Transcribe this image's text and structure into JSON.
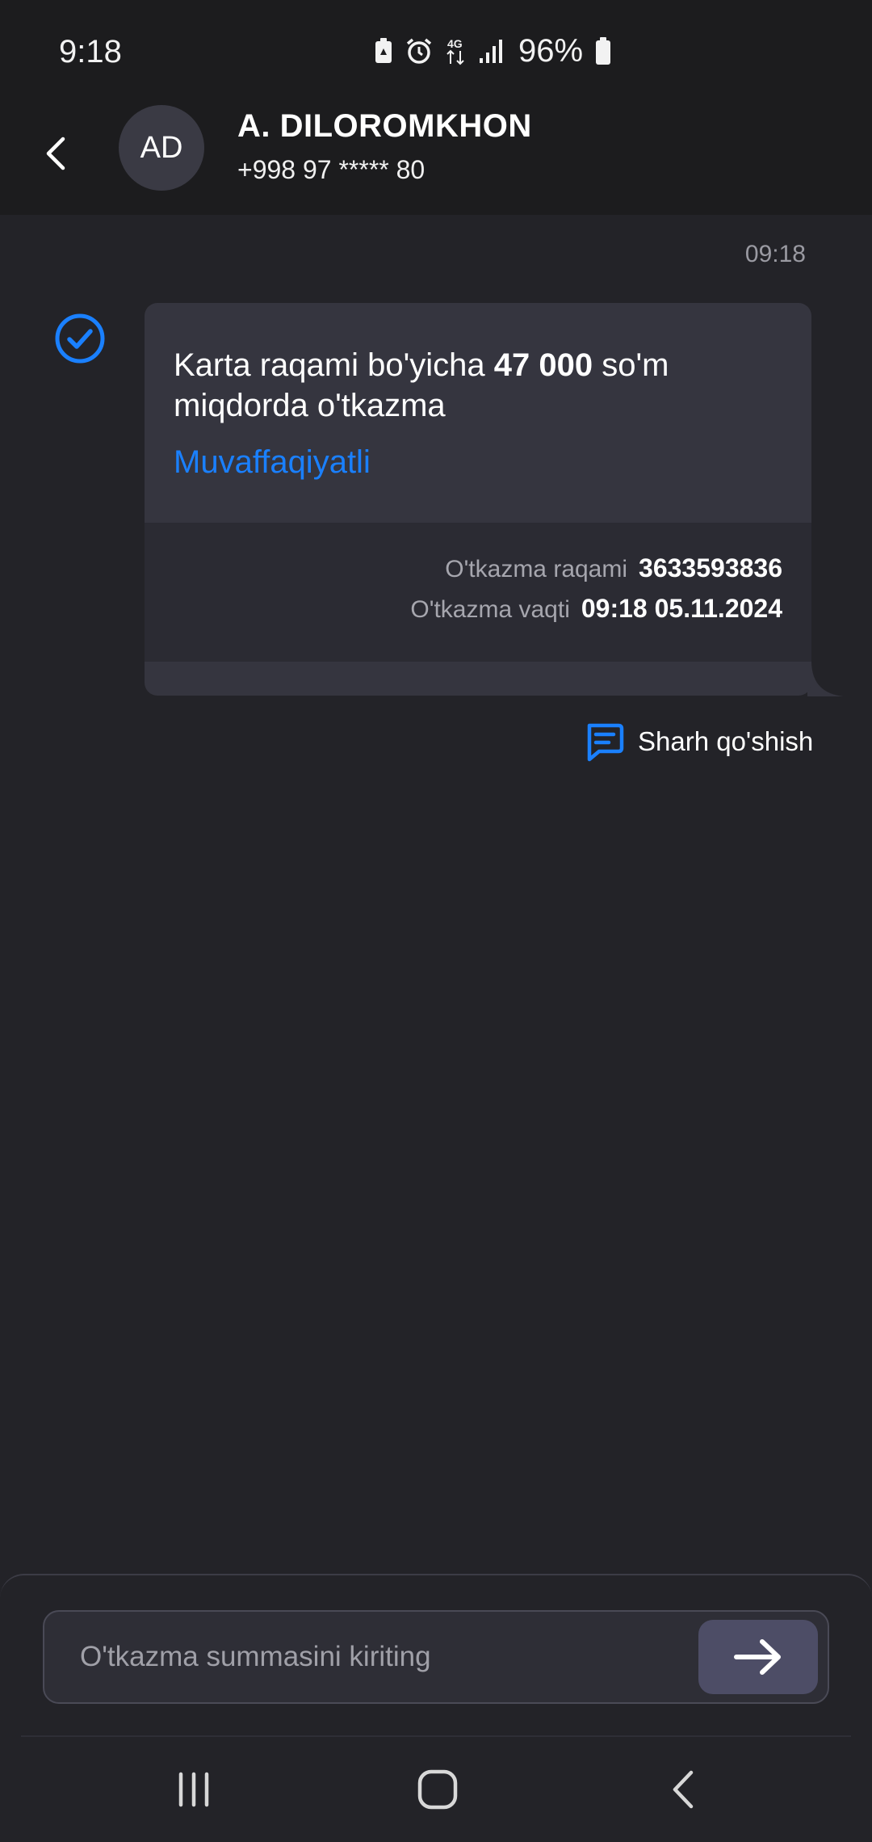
{
  "status_bar": {
    "time": "9:18",
    "network": "4G",
    "battery": "96%",
    "icons": [
      "battery-saver-icon",
      "alarm-icon",
      "network-4g-icon",
      "signal-icon",
      "battery-icon"
    ]
  },
  "header": {
    "avatar_initials": "AD",
    "name": "A. DILOROMKHON",
    "phone": "+998 97 ***** 80"
  },
  "message": {
    "time": "09:18",
    "title_prefix": "Karta raqami bo'yicha",
    "amount": "47 000",
    "title_suffix": "so'm miqdorda o'tkazma",
    "status": "Muvaffaqiyatli",
    "details": [
      {
        "label": "O'tkazma raqami",
        "value": "3633593836"
      },
      {
        "label": "O'tkazma vaqti",
        "value": "09:18 05.11.2024"
      }
    ],
    "comment_label": "Sharh qo'shish"
  },
  "input": {
    "placeholder": "O'tkazma summasini kiriting",
    "value": ""
  },
  "colors": {
    "accent": "#1a80ff",
    "background": "#232328",
    "card": "#35353f",
    "send_button": "#4d4d66"
  }
}
